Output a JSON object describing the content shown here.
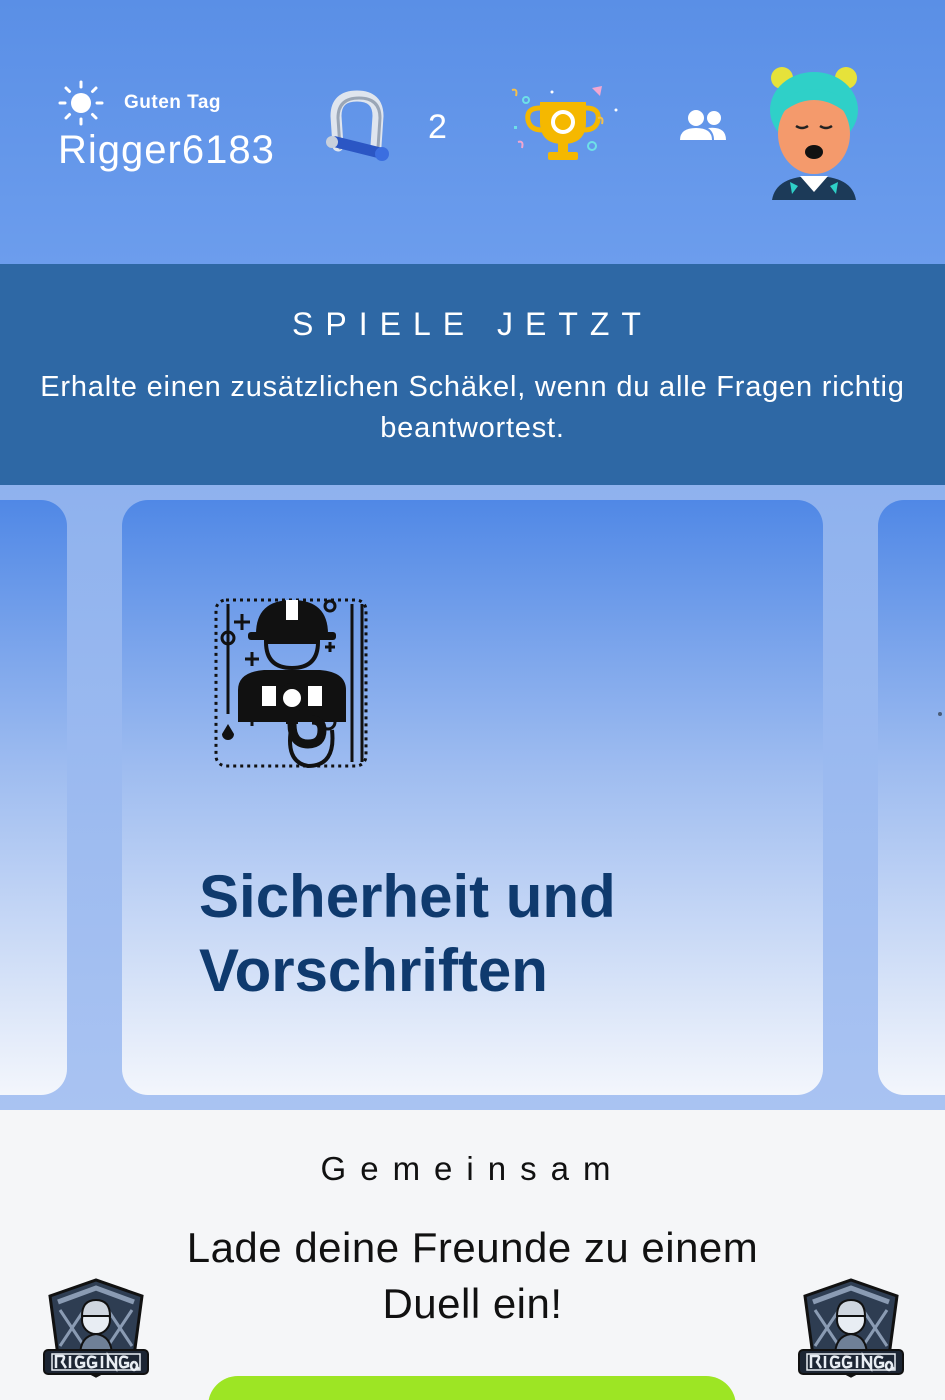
{
  "header": {
    "greeting": "Guten Tag",
    "username": "Rigger6183",
    "shackle_count": "2",
    "icons": [
      "sun-icon",
      "shackle-icon",
      "trophy-icon",
      "friends-icon",
      "avatar"
    ]
  },
  "promo": {
    "title": "SPIELE JETZT",
    "text": "Erhalte einen zusätzlichen Schäkel, wenn du alle Fragen richtig beantwortest."
  },
  "carousel": {
    "current_card": {
      "title": "Sicherheit und Vorschriften",
      "icon": "rigger-hook-icon"
    }
  },
  "social": {
    "title": "Gemeinsam",
    "text": "Lade deine Freunde zu einem Duell ein!",
    "logo_text": "RIGGINGQUIZ"
  },
  "colors": {
    "header_bg": "#5a8fe6",
    "promo_bg": "#2e68a5",
    "card_title": "#0f3a6e",
    "button": "#9de524"
  }
}
